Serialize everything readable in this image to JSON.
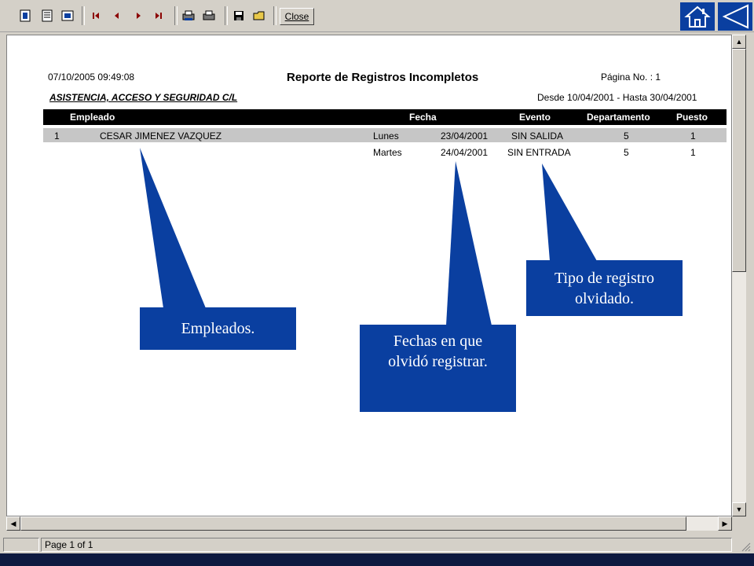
{
  "toolbar": {
    "close_label": "Close",
    "icons": [
      "one-page-icon",
      "two-page-icon",
      "page-width-icon",
      "first-page-icon",
      "previous-page-icon",
      "next-page-icon",
      "last-page-icon",
      "printer-setup-icon",
      "print-icon",
      "save-icon",
      "open-icon"
    ]
  },
  "nav_buttons": {
    "home_icon": "home-icon",
    "back_icon": "back-triangle-icon"
  },
  "report": {
    "datetime": "07/10/2005 09:49:08",
    "title": "Reporte de Registros Incompletos",
    "page_label": "Página No. : 1",
    "company": "ASISTENCIA, ACCESO Y SEGURIDAD C/L",
    "date_range": "Desde 10/04/2001 - Hasta 30/04/2001",
    "columns": [
      "Empleado",
      "Fecha",
      "Evento",
      "Departamento",
      "Puesto"
    ],
    "employee": {
      "number": "1",
      "name": "CESAR JIMENEZ VAZQUEZ"
    },
    "rows": [
      {
        "day": "Lunes",
        "date": "23/04/2001",
        "event": "SIN SALIDA",
        "department": "5",
        "position": "1"
      },
      {
        "day": "Martes",
        "date": "24/04/2001",
        "event": "SIN ENTRADA",
        "department": "5",
        "position": "1"
      }
    ]
  },
  "callouts": {
    "employees": "Empleados.",
    "dates_line1": "Fechas en que",
    "dates_line2": "olvidó registrar.",
    "type_line1": "Tipo de registro",
    "type_line2": "olvidado."
  },
  "status": {
    "page_text": "Page 1 of 1"
  },
  "colors": {
    "callout_blue": "#0a3fa0",
    "header_black": "#000000",
    "row_gray": "#c6c6c6"
  }
}
